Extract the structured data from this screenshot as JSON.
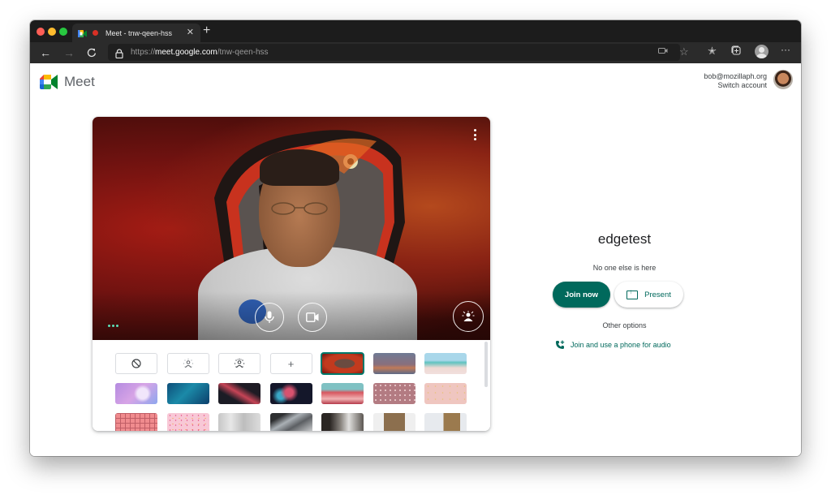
{
  "browser": {
    "tab": {
      "title": "Meet - tnw-qeen-hss",
      "recording_indicator_color": "#d93025",
      "close_icon": "close-icon"
    },
    "new_tab_label": "+",
    "url": {
      "scheme": "https://",
      "host": "meet.google.com",
      "path": "/tnw-qeen-hss"
    },
    "toolbar_icons": [
      "back-icon",
      "forward-icon",
      "reload-icon",
      "lock-icon",
      "camera-permission-icon",
      "favorite-star-icon",
      "favorites-icon",
      "collections-icon",
      "profile-icon",
      "more-icon"
    ],
    "more_label": "···"
  },
  "header": {
    "app_name": "Meet",
    "account_email": "bob@mozillaph.org",
    "switch_account_label": "Switch account"
  },
  "preview": {
    "controls": {
      "mic": "microphone-icon",
      "camera": "video-camera-icon",
      "effects": "background-effects-icon",
      "more": "more-vertical-icon"
    },
    "audio_indicator_color": "#5ce0b8",
    "backgrounds": {
      "options": [
        {
          "type": "none",
          "label": "⦸",
          "name": "no-effect"
        },
        {
          "type": "blur-slight",
          "label": "",
          "name": "slight-blur"
        },
        {
          "type": "blur",
          "label": "",
          "name": "blur"
        },
        {
          "type": "add",
          "label": "+",
          "name": "add-background"
        }
      ],
      "images": [
        {
          "name": "dinosaur",
          "selected": true
        },
        {
          "name": "sunset-gradient",
          "selected": false
        },
        {
          "name": "beach",
          "selected": false
        },
        {
          "name": "pink-clouds",
          "selected": false
        },
        {
          "name": "underwater",
          "selected": false
        },
        {
          "name": "space-nebula",
          "selected": false
        },
        {
          "name": "fireworks",
          "selected": false
        },
        {
          "name": "flowers-sky",
          "selected": false
        },
        {
          "name": "flower-field",
          "selected": false
        },
        {
          "name": "pink-sparkles",
          "selected": false
        },
        {
          "name": "pink-pattern",
          "selected": false
        },
        {
          "name": "confetti",
          "selected": false
        },
        {
          "name": "bright-office",
          "selected": false
        },
        {
          "name": "modern-interior",
          "selected": false
        },
        {
          "name": "dark-room",
          "selected": false
        },
        {
          "name": "bookshelf",
          "selected": false
        },
        {
          "name": "living-room",
          "selected": false
        }
      ]
    }
  },
  "join_panel": {
    "meeting_name": "edgetest",
    "status": "No one else is here",
    "join_label": "Join now",
    "present_label": "Present",
    "other_options_label": "Other options",
    "phone_link_label": "Join and use a phone for audio",
    "accent_color": "#00695c"
  }
}
